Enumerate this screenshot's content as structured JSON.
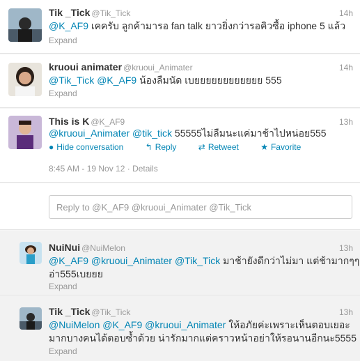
{
  "tweets": [
    {
      "name": "Tik _Tick",
      "handle": "@Tik_Tick",
      "time": "14h",
      "mentions": [
        "@K_AF9"
      ],
      "text": " เคครับ ลูกค้ามารอ fan talk ยาวยิ่งกว่ารอคิวซื้อ iphone 5 แล้ว",
      "expand": "Expand"
    },
    {
      "name": "kruoui animater",
      "handle": "@kruoui_Animater",
      "time": "14h",
      "mentions": [
        "@Tik_Tick",
        "@K_AF9"
      ],
      "text": " น้องลืมนัด เบยยยยยยยยยยยย 555",
      "expand": "Expand"
    },
    {
      "name": "This is K",
      "handle": "@K_AF9",
      "time": "13h",
      "mentions": [
        "@kruoui_Animater",
        "@tik_tick"
      ],
      "text": " 55555ไม่ลืมนะแค่มาช้าไปหน่อย555",
      "actions": {
        "hide": "Hide conversation",
        "reply": "Reply",
        "retweet": "Retweet",
        "favorite": "Favorite"
      },
      "timestamp": "8:45 AM - 19 Nov 12",
      "details": "Details"
    }
  ],
  "reply_box": {
    "placeholder": "Reply to @K_AF9 @kruoui_Animater @Tik_Tick"
  },
  "replies": [
    {
      "name": "NuiNui",
      "handle": "@NuiMelon",
      "time": "13h",
      "mentions": [
        "@K_AF9",
        "@kruoui_Animater",
        "@Tik_Tick"
      ],
      "text_line1": " มาช้ายังดีกว่าไม่มา แต่ช้ามากๆๆ",
      "text_line2": "อ่า555เบยยย",
      "expand": "Expand"
    },
    {
      "name": "Tik _Tick",
      "handle": "@Tik_Tick",
      "time": "13h",
      "mentions": [
        "@NuiMelon",
        "@K_AF9",
        "@kruoui_Animater"
      ],
      "text_line1": " ให้อภัยค่ะเพราะเห็นตอบเยอะ",
      "text_line2": "มากบางคนได้ตอบซ้ำด้วย น่ารักมากแต่คราวหน้าอย่าให้รอนานอีกนะ5555",
      "expand": "Expand"
    }
  ]
}
